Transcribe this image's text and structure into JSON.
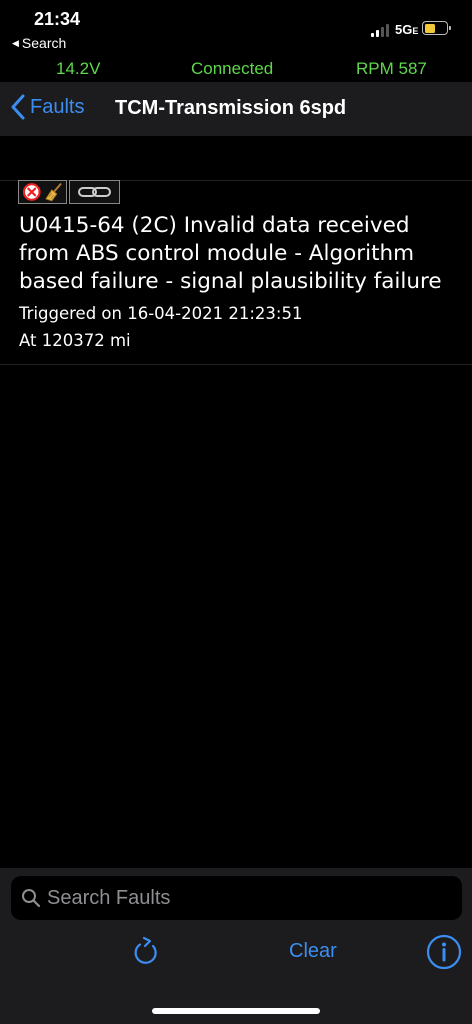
{
  "status_bar": {
    "time": "21:34",
    "back_app": "Search",
    "network": "5G",
    "network_suffix": "E",
    "battery_color": "#f0c93a"
  },
  "telemetry": {
    "voltage": "14.2V",
    "connection": "Connected",
    "rpm": "RPM 587",
    "color": "#5ed84b"
  },
  "nav": {
    "back_label": "Faults",
    "title": "TCM-Transmission 6spd",
    "accent": "#3b8ef0"
  },
  "faults": [
    {
      "icons": [
        "error-circle-icon",
        "broom-icon",
        "chain-link-icon"
      ],
      "title": "U0415-64 (2C) Invalid data received from ABS control module - Algorithm based failure - signal plausibility failure",
      "triggered": "Triggered on 16-04-2021 21:23:51",
      "mileage": "At 120372 mi"
    }
  ],
  "search": {
    "placeholder": "Search Faults"
  },
  "toolbar": {
    "clear_label": "Clear",
    "icons": [
      "refresh-icon",
      "info-icon"
    ]
  }
}
